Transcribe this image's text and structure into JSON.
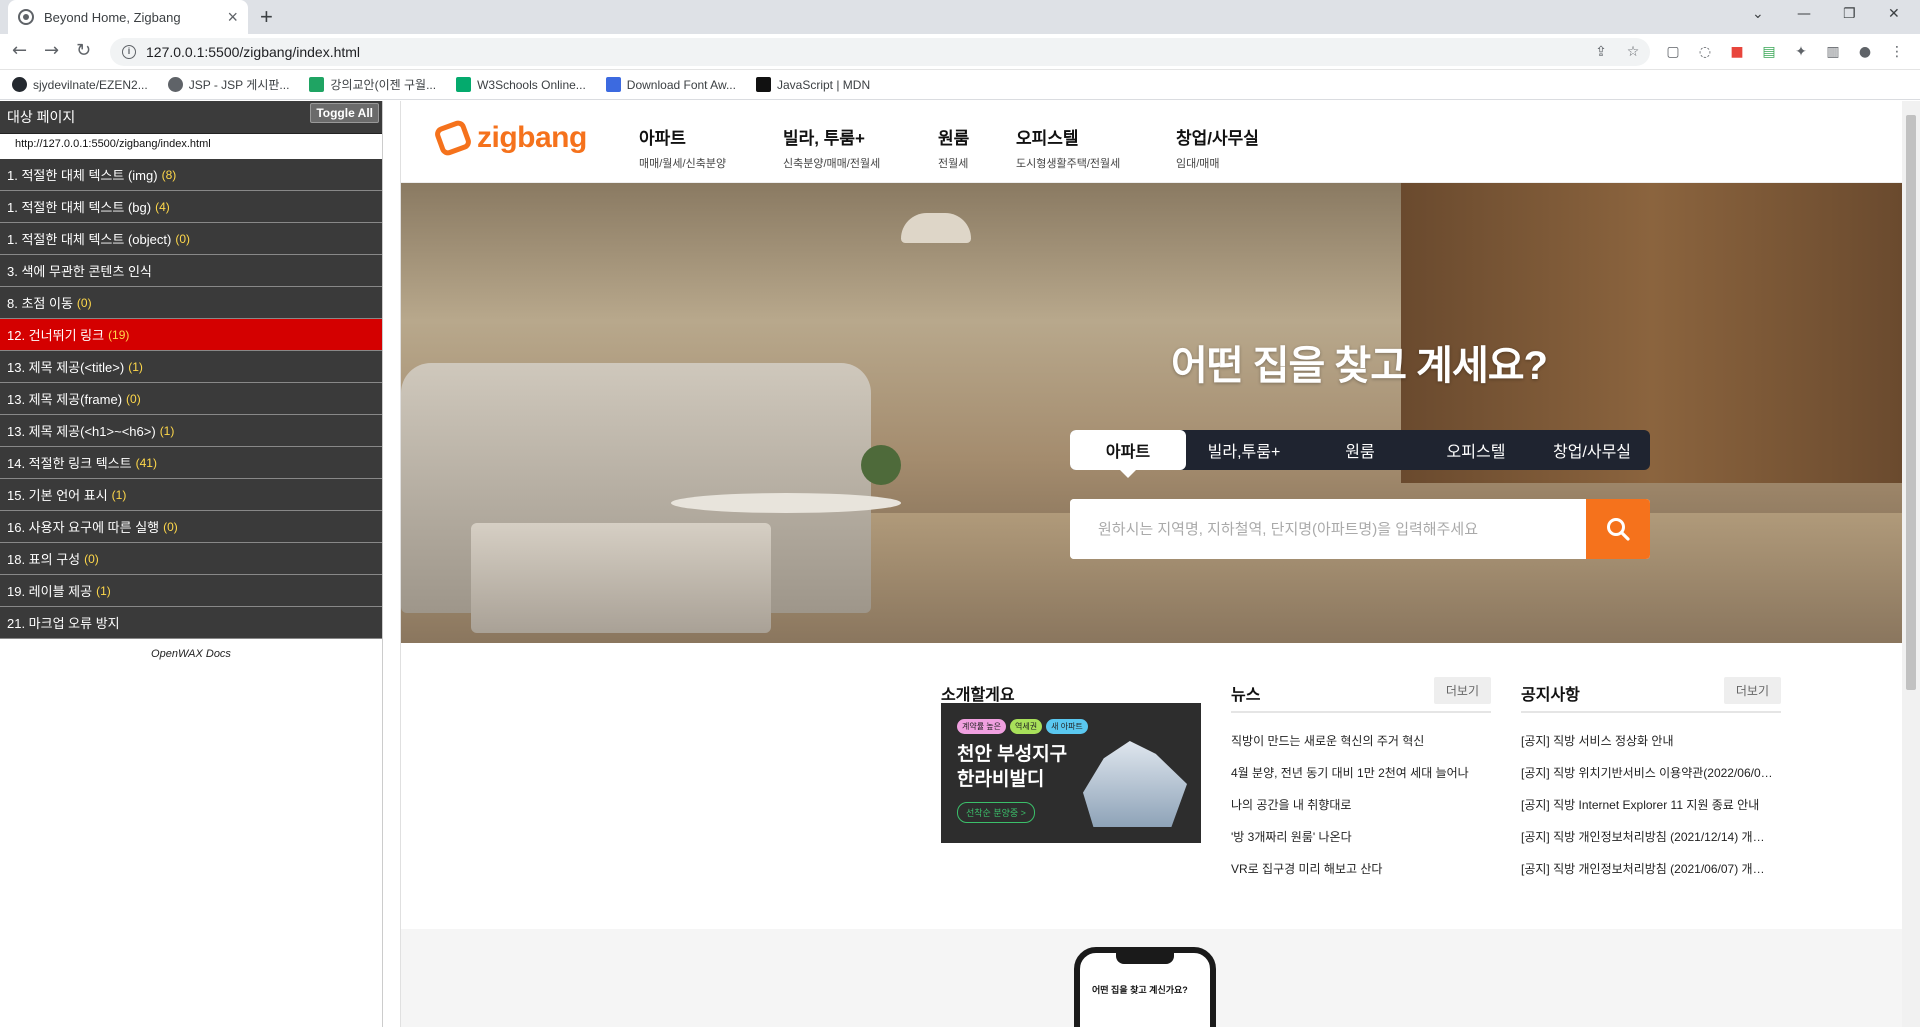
{
  "browser": {
    "tab_title": "Beyond Home, Zigbang",
    "new_tab": "+",
    "url": "127.0.0.1:5500/zigbang/index.html",
    "bookmarks": [
      {
        "label": "sjydevilnate/EZEN2...",
        "icon": "github-icon"
      },
      {
        "label": "JSP - JSP 게시판...",
        "icon": "globe-icon"
      },
      {
        "label": "강의교안(이젠 구월...",
        "icon": "google-drive-icon"
      },
      {
        "label": "W3Schools Online...",
        "icon": "w3schools-icon"
      },
      {
        "label": "Download Font Aw...",
        "icon": "flag-icon"
      },
      {
        "label": "JavaScript | MDN",
        "icon": "mdn-icon"
      }
    ]
  },
  "panel": {
    "title": "대상 페이지",
    "toggle": "Toggle All",
    "url": "http://127.0.0.1:5500/zigbang/index.html",
    "items": [
      {
        "label": "1. 적절한 대체 텍스트 (img)",
        "count": "(8)"
      },
      {
        "label": "1. 적절한 대체 텍스트 (bg)",
        "count": "(4)"
      },
      {
        "label": "1. 적절한 대체 텍스트 (object)",
        "count": "(0)"
      },
      {
        "label": "3. 색에 무관한 콘텐츠 인식",
        "count": ""
      },
      {
        "label": "8. 초점 이동",
        "count": "(0)"
      },
      {
        "label": "12. 건너뛰기 링크",
        "count": "(19)",
        "active": true
      },
      {
        "label": "13. 제목 제공(<title>)",
        "count": "(1)"
      },
      {
        "label": "13. 제목 제공(frame)",
        "count": "(0)"
      },
      {
        "label": "13. 제목 제공(<h1>~<h6>)",
        "count": "(1)"
      },
      {
        "label": "14. 적절한 링크 텍스트",
        "count": "(41)"
      },
      {
        "label": "15. 기본 언어 표시",
        "count": "(1)"
      },
      {
        "label": "16. 사용자 요구에 따른 실행",
        "count": "(0)"
      },
      {
        "label": "18. 표의 구성",
        "count": "(0)"
      },
      {
        "label": "19. 레이블 제공",
        "count": "(1)"
      },
      {
        "label": "21. 마크업 오류 방지",
        "count": ""
      }
    ],
    "footer": "OpenWAX Docs"
  },
  "site": {
    "logo": "zigbang",
    "menu": [
      {
        "title": "아파트",
        "sub": "매매/월세/신축분양"
      },
      {
        "title": "빌라, 투룸+",
        "sub": "신축분양/매매/전월세"
      },
      {
        "title": "원룸",
        "sub": "전월세"
      },
      {
        "title": "오피스텔",
        "sub": "도시형생활주택/전월세"
      },
      {
        "title": "창업/사무실",
        "sub": "임대/매매"
      }
    ],
    "hero_title": "어떤 집을 찾고 계세요?",
    "search_tabs": [
      "아파트",
      "빌라,투룸+",
      "원룸",
      "오피스텔",
      "창업/사무실"
    ],
    "search_placeholder": "원하시는 지역명, 지하철역, 단지명(아파트명)을 입력해주세요",
    "intro": {
      "title": "소개할게요",
      "promo_tags": [
        "계약률 높은",
        "역세권",
        "새 아파트"
      ],
      "promo_title_1": "천안 부성지구",
      "promo_title_2": "한라비발디",
      "promo_button": "선착순 분양중 >"
    },
    "news": {
      "title": "뉴스",
      "more": "더보기",
      "items": [
        "직방이 만드는 새로운 혁신의 주거 혁신",
        "4월 분양, 전년 동기 대비 1만 2천여 세대 늘어나",
        "나의 공간을 내 취향대로",
        "'방 3개짜리 원룸' 나온다",
        "VR로 집구경 미리 해보고 산다"
      ]
    },
    "notice": {
      "title": "공지사항",
      "more": "더보기",
      "items": [
        "[공지] 직방 서비스 정상화 안내",
        "[공지] 직방 위치기반서비스 이용약관(2022/06/0…",
        "[공지] 직방 Internet Explorer 11 지원 종료 안내",
        "[공지] 직방 개인정보처리방침 (2021/12/14) 개…",
        "[공지] 직방 개인정보처리방침 (2021/06/07) 개…"
      ]
    },
    "phone_text": "어떤 집을 찾고 계신가요?"
  },
  "colors": {
    "brand": "#f5721c",
    "panel_active": "#d40000",
    "panel_bg": "#3a3a3a"
  }
}
